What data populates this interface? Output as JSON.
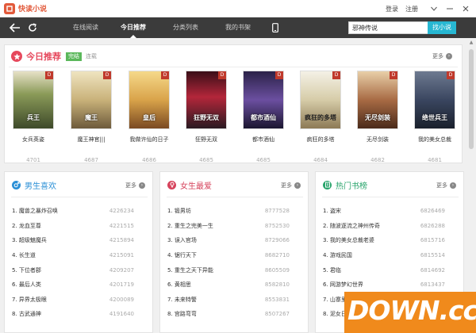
{
  "app": {
    "title": "快读小说"
  },
  "titlebar": {
    "login": "登录",
    "register": "注册",
    "menu_icon": "dropdown-icon",
    "min_icon": "minimize-icon",
    "close_icon": "close-icon"
  },
  "nav": {
    "tabs": [
      "在线阅读",
      "今日推荐",
      "分类列表",
      "我的书架"
    ],
    "active": "今日推荐",
    "search_value": "邪神传说",
    "search_button": "找小说",
    "bg_color": "#3b3b3b",
    "accent": "#27b7d2"
  },
  "today": {
    "title": "今日推荐",
    "tag_active": "完结",
    "tag_inactive": "连载",
    "more": "更多",
    "books": [
      {
        "cover_text": "兵王",
        "name": "女兵英姿",
        "count": "4701",
        "color": "#6b7a44"
      },
      {
        "cover_text": "魔王",
        "name": "魔王神官|||",
        "count": "4687",
        "color": "#b6a37a"
      },
      {
        "cover_text": "皇后",
        "name": "我做许仙的日子",
        "count": "4686",
        "color": "#d1a24a"
      },
      {
        "cover_text": "狂野无双",
        "name": "狂野无双",
        "count": "4685",
        "color": "#9a1f2e"
      },
      {
        "cover_text": "都市酒仙",
        "name": "都市酒仙",
        "count": "4685",
        "color": "#5a3f8a"
      },
      {
        "cover_text": "疯狂的多塔",
        "name": "疯狂的多塔",
        "count": "4684",
        "color": "#c7c0a6"
      },
      {
        "cover_text": "无尽剑装",
        "name": "无尽剑装",
        "count": "4682",
        "color": "#8b5a3c"
      },
      {
        "cover_text": "绝世兵王",
        "name": "我的美女总裁",
        "count": "4681",
        "color": "#394458"
      }
    ]
  },
  "panels": [
    {
      "title": "男生喜欢",
      "more": "更多",
      "color": "#2a8fd6",
      "icon": "male-icon",
      "rows": [
        {
          "rank": "1.",
          "name": "魔兽之暴炸召唤",
          "num": "4226234"
        },
        {
          "rank": "2.",
          "name": "龙血至尊",
          "num": "4221515"
        },
        {
          "rank": "3.",
          "name": "超级魅魔兵",
          "num": "4215894"
        },
        {
          "rank": "4.",
          "name": "长生道",
          "num": "4215091"
        },
        {
          "rank": "5.",
          "name": "下位者郡",
          "num": "4209207"
        },
        {
          "rank": "6.",
          "name": "最后人类",
          "num": "4201719"
        },
        {
          "rank": "7.",
          "name": "异界太极眼",
          "num": "4200089"
        },
        {
          "rank": "8.",
          "name": "古武通神",
          "num": "4191640"
        }
      ]
    },
    {
      "title": "女生最爱",
      "more": "更多",
      "color": "#d6435c",
      "icon": "female-icon",
      "rows": [
        {
          "rank": "1.",
          "name": "锻男坊",
          "num": "8777528"
        },
        {
          "rank": "2.",
          "name": "重生之完美一生",
          "num": "8752530"
        },
        {
          "rank": "3.",
          "name": "误入官场",
          "num": "8729066"
        },
        {
          "rank": "4.",
          "name": "锯行天下",
          "num": "8682710"
        },
        {
          "rank": "5.",
          "name": "重生之天下异能",
          "num": "8605509"
        },
        {
          "rank": "6.",
          "name": "黄相思",
          "num": "8582810"
        },
        {
          "rank": "7.",
          "name": "未来特警",
          "num": "8553831"
        },
        {
          "rank": "8.",
          "name": "宫路弯弯",
          "num": "8507267"
        }
      ]
    },
    {
      "title": "热门书榜",
      "more": "更多",
      "color": "#2aa56c",
      "icon": "book-icon",
      "rows": [
        {
          "rank": "1.",
          "name": "盗宋",
          "num": "6826469"
        },
        {
          "rank": "2.",
          "name": "随波逐流之神州传奇",
          "num": "6826288"
        },
        {
          "rank": "3.",
          "name": "我的美女总裁老婆",
          "num": "6815716"
        },
        {
          "rank": "4.",
          "name": "游戏民国",
          "num": "6815514"
        },
        {
          "rank": "5.",
          "name": "君临",
          "num": "6814692"
        },
        {
          "rank": "6.",
          "name": "网游梦幻世界",
          "num": "6813437"
        },
        {
          "rank": "7.",
          "name": "山寨里的",
          "num": ""
        },
        {
          "rank": "8.",
          "name": "泥女日记",
          "num": ""
        }
      ]
    }
  ],
  "watermark": {
    "text": "DOWN.cc"
  }
}
